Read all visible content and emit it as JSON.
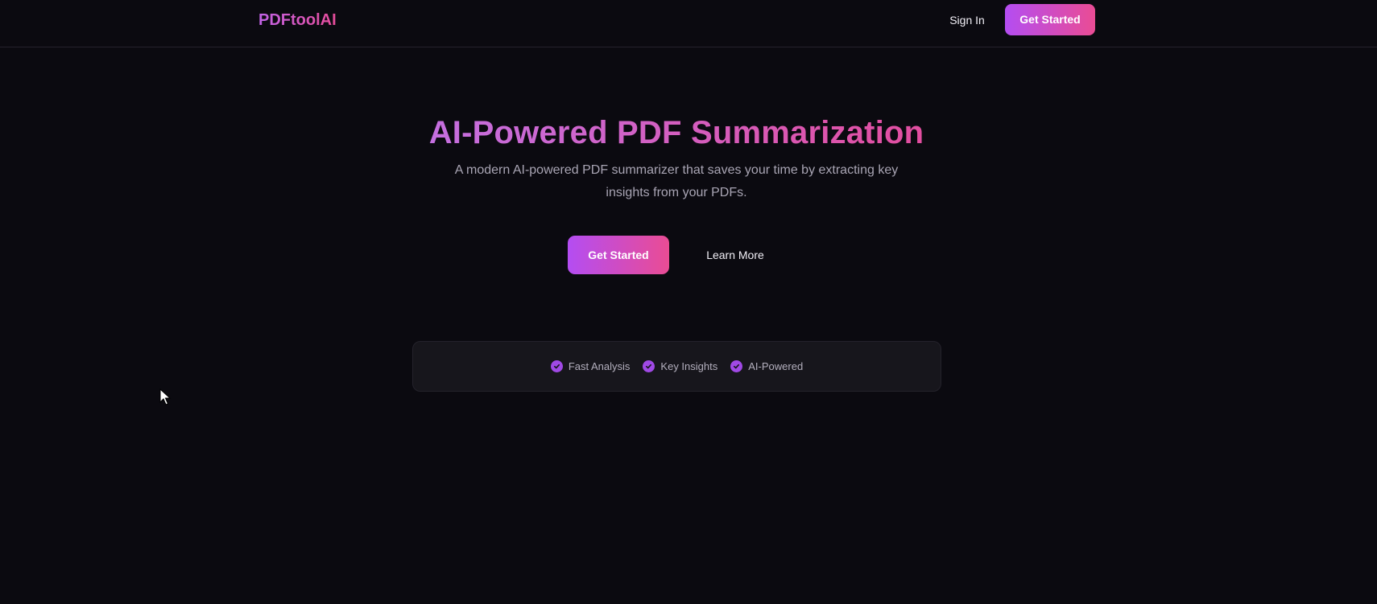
{
  "header": {
    "logo": "PDFtoolAI",
    "sign_in": "Sign In",
    "cta": "Get Started"
  },
  "hero": {
    "title": "AI-Powered PDF Summarization",
    "subtitle": "A modern AI-powered PDF summarizer that saves your time by extracting key insights from your PDFs.",
    "primary_cta": "Get Started",
    "secondary_cta": "Learn More"
  },
  "features": [
    {
      "label": "Fast Analysis",
      "icon": "check-circle-icon"
    },
    {
      "label": "Key Insights",
      "icon": "check-circle-icon"
    },
    {
      "label": "AI-Powered",
      "icon": "check-circle-icon"
    }
  ],
  "colors": {
    "background": "#0b0a10",
    "accent_start": "#b44df2",
    "accent_end": "#ea4c94",
    "check": "#a049e5"
  }
}
